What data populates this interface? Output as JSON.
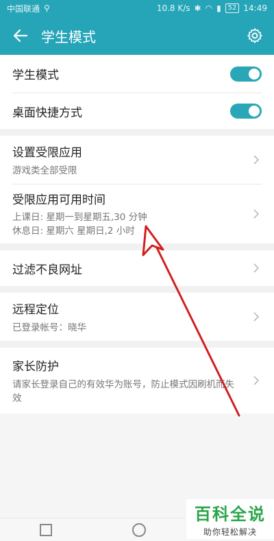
{
  "status_bar": {
    "carrier": "中国联通",
    "speed": "10.8 K/s",
    "battery": "52",
    "time": "14:49"
  },
  "app_bar": {
    "title": "学生模式"
  },
  "toggles": [
    {
      "label": "学生模式",
      "on": true
    },
    {
      "label": "桌面快捷方式",
      "on": true
    }
  ],
  "restricted_apps": {
    "label": "设置受限应用",
    "sub": "游戏类全部受限"
  },
  "usage_time": {
    "label": "受限应用可用时间",
    "line1": "上课日: 星期一到星期五,30 分钟",
    "line2": "休息日: 星期六 星期日,2 小时"
  },
  "filter": {
    "label": "过滤不良网址"
  },
  "location": {
    "label": "远程定位",
    "sub": "已登录帐号：晓华"
  },
  "parental": {
    "label": "家长防护",
    "sub": "请家长登录自己的有效华为账号，防止模式因刷机而失效"
  },
  "watermark": {
    "main": "百科全说",
    "sub": "助你轻松解决"
  },
  "colors": {
    "accent": "#26a5b8",
    "arrow": "#d11f1f",
    "watermark_green": "#2aa54a"
  }
}
